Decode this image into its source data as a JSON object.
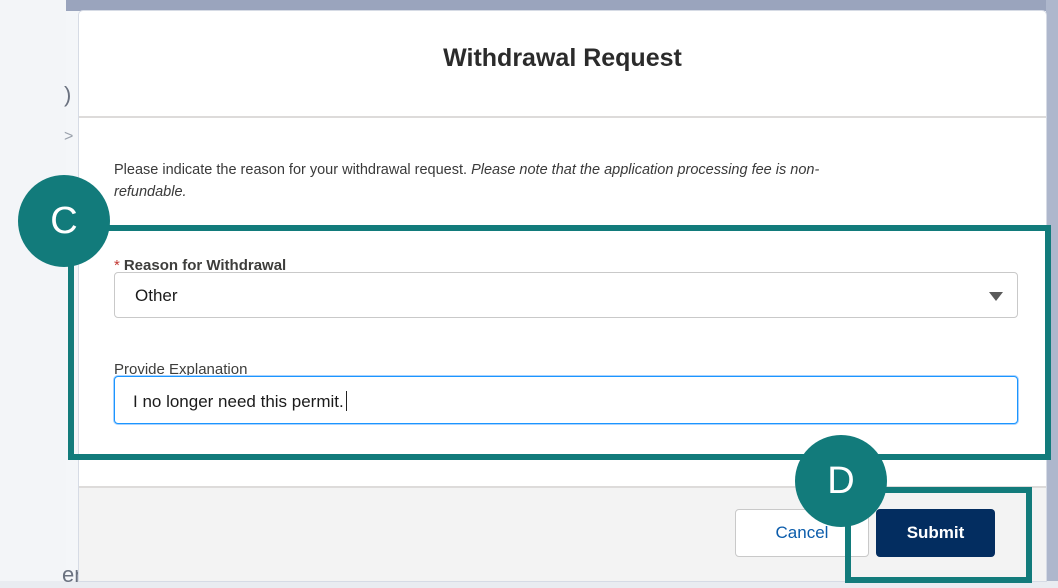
{
  "background": {
    "paren_fragment": ")",
    "arrow_fragment": ">",
    "bottom_fragment": "ended Use"
  },
  "modal": {
    "title": "Withdrawal Request",
    "intro_text": "Please indicate the reason for your withdrawal request. ",
    "intro_italic": "Please note that the application processing fee is non-refundable.",
    "reason_required_marker": "*",
    "reason_label": "Reason for Withdrawal",
    "reason_selected": "Other",
    "explanation_label": "Provide Explanation",
    "explanation_value": "I no longer need this permit.",
    "cancel_label": "Cancel",
    "submit_label": "Submit"
  },
  "annotations": {
    "badge_c": "C",
    "badge_d": "D",
    "highlight_color": "#127b7b"
  },
  "colors": {
    "submit_bg": "#032d60",
    "focus_border": "#1b96ff",
    "required_star": "#c23934"
  },
  "icons": {
    "select_arrow": "caret-down-icon"
  }
}
